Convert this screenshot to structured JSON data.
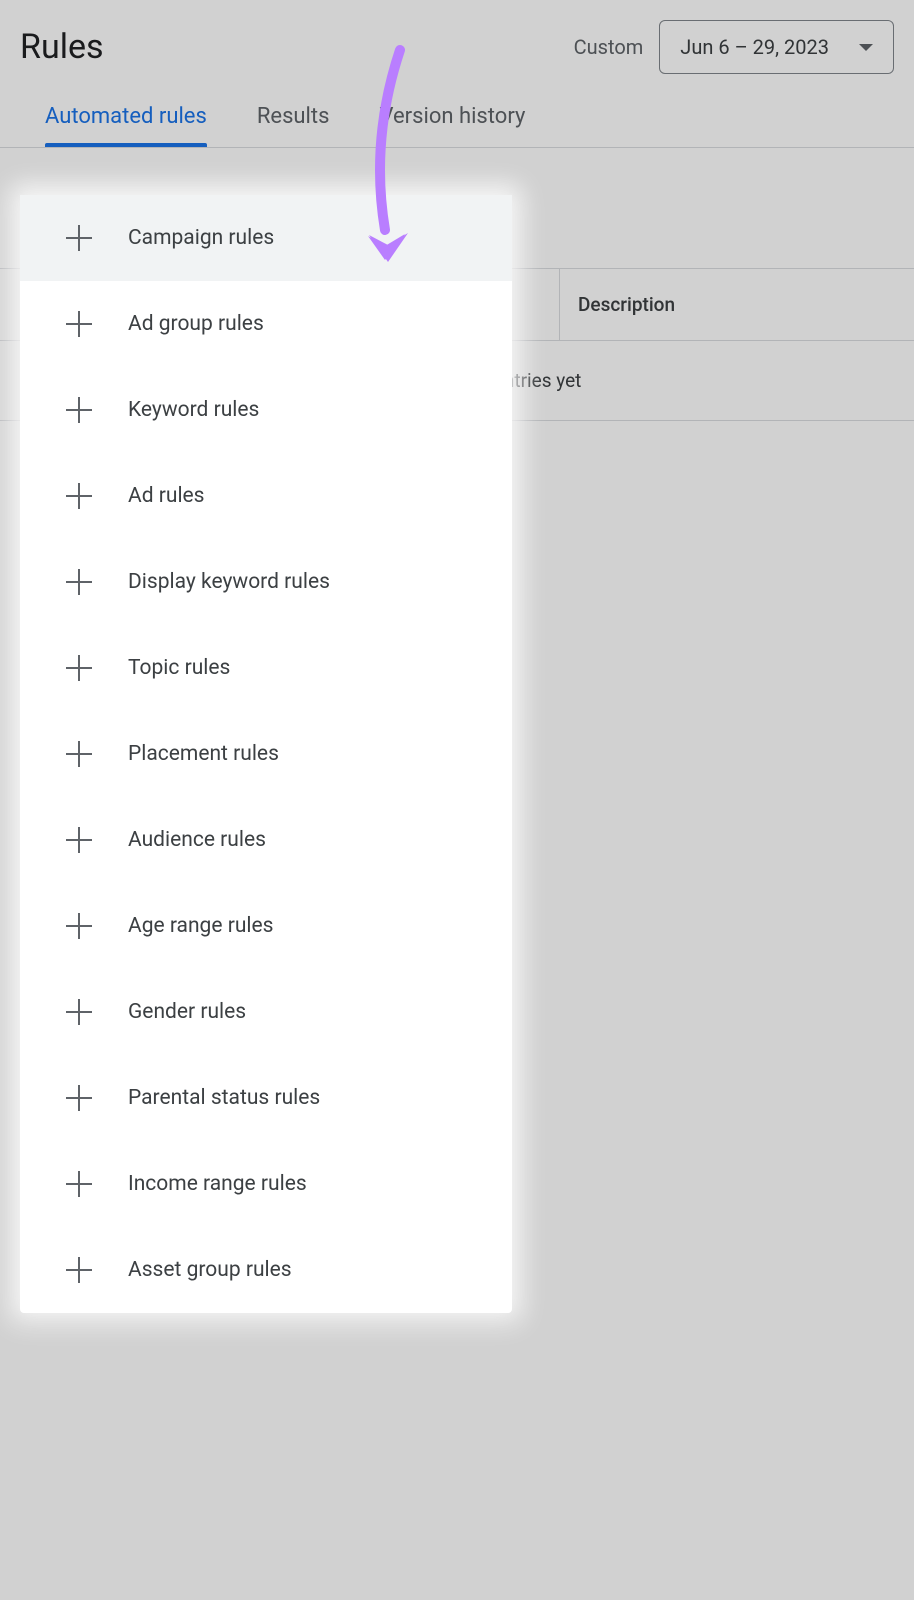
{
  "header": {
    "title": "Rules",
    "dateLabel": "Custom",
    "dateRange": "Jun 6 – 29, 2023"
  },
  "tabs": [
    {
      "label": "Automated rules",
      "active": true
    },
    {
      "label": "Results",
      "active": false
    },
    {
      "label": "Version history",
      "active": false
    }
  ],
  "table": {
    "columns": [
      "",
      "Description"
    ],
    "emptyMessage": "You don't have any entries yet"
  },
  "menu": {
    "items": [
      {
        "label": "Campaign rules",
        "highlighted": true
      },
      {
        "label": "Ad group rules",
        "highlighted": false
      },
      {
        "label": "Keyword rules",
        "highlighted": false
      },
      {
        "label": "Ad rules",
        "highlighted": false
      },
      {
        "label": "Display keyword rules",
        "highlighted": false
      },
      {
        "label": "Topic rules",
        "highlighted": false
      },
      {
        "label": "Placement rules",
        "highlighted": false
      },
      {
        "label": "Audience rules",
        "highlighted": false
      },
      {
        "label": "Age range rules",
        "highlighted": false
      },
      {
        "label": "Gender rules",
        "highlighted": false
      },
      {
        "label": "Parental status rules",
        "highlighted": false
      },
      {
        "label": "Income range rules",
        "highlighted": false
      },
      {
        "label": "Asset group rules",
        "highlighted": false
      }
    ]
  }
}
